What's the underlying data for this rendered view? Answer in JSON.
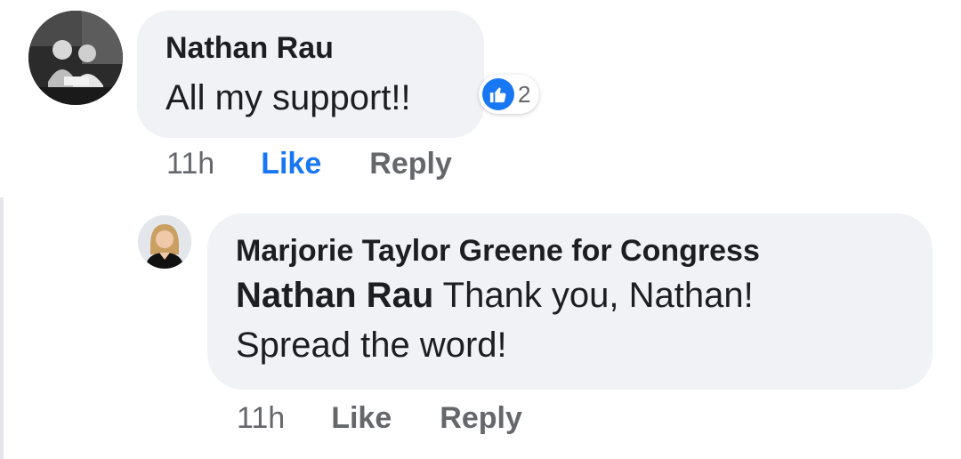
{
  "comment": {
    "author": "Nathan Rau",
    "text": "All my support!!",
    "reaction": {
      "icon": "thumbs-up-icon",
      "count": "2",
      "color": "#1877f2"
    },
    "time": "11h",
    "like_label": "Like",
    "reply_label": "Reply",
    "liked": true
  },
  "reply": {
    "author": "Marjorie Taylor Greene for Congress",
    "mention": "Nathan Rau",
    "text": "Thank you, Nathan! Spread the word!",
    "time": "11h",
    "like_label": "Like",
    "reply_label": "Reply",
    "liked": false
  },
  "colors": {
    "bubble": "#f0f2f5",
    "primary_text": "#1c1e21",
    "secondary_text": "#65676b",
    "accent": "#1877f2"
  }
}
